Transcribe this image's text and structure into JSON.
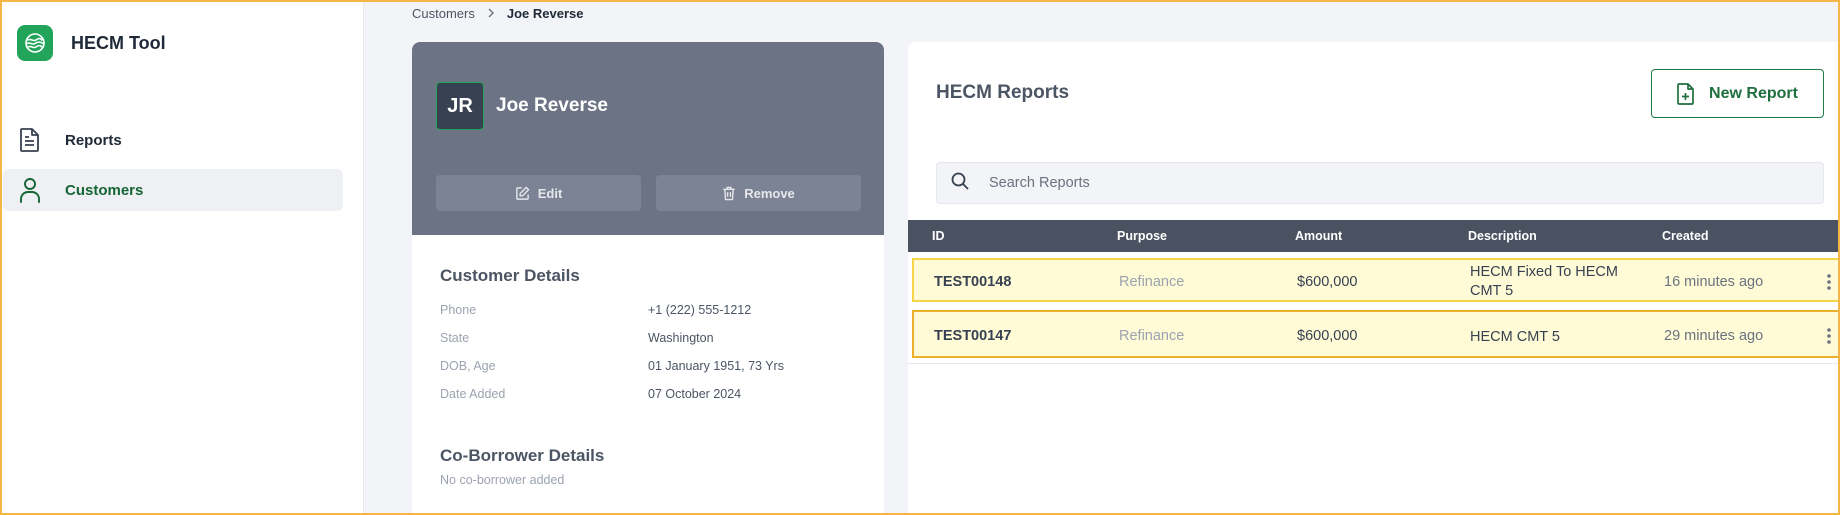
{
  "app": {
    "name": "HECM Tool"
  },
  "sidebar": {
    "items": [
      {
        "label": "Reports"
      },
      {
        "label": "Customers"
      }
    ]
  },
  "breadcrumb": {
    "parent": "Customers",
    "current": "Joe Reverse"
  },
  "customer": {
    "initials": "JR",
    "name": "Joe Reverse",
    "edit_label": "Edit",
    "remove_label": "Remove",
    "details_title": "Customer Details",
    "details": [
      {
        "label": "Phone",
        "value": "+1 (222) 555-1212"
      },
      {
        "label": "State",
        "value": "Washington"
      },
      {
        "label": "DOB, Age",
        "value": "01 January 1951, 73 Yrs"
      },
      {
        "label": "Date Added",
        "value": "07 October 2024"
      }
    ],
    "coborrower_title": "Co-Borrower Details",
    "coborrower_empty": "No co-borrower added"
  },
  "reports": {
    "title": "HECM Reports",
    "new_label": "New Report",
    "search_placeholder": "Search Reports",
    "columns": {
      "id": "ID",
      "purpose": "Purpose",
      "amount": "Amount",
      "description": "Description",
      "created": "Created"
    },
    "rows": [
      {
        "id": "TEST00148",
        "purpose": "Refinance",
        "amount": "$600,000",
        "description": "HECM Fixed To HECM CMT 5",
        "created": "16 minutes ago"
      },
      {
        "id": "TEST00147",
        "purpose": "Refinance",
        "amount": "$600,000",
        "description": "HECM CMT 5",
        "created": "29 minutes ago"
      }
    ]
  },
  "colors": {
    "brand": "#22a55a",
    "accent_green": "#166534",
    "header_gray": "#6b7385",
    "table_head": "#4a5262",
    "row_highlight": "#fefbd6"
  }
}
